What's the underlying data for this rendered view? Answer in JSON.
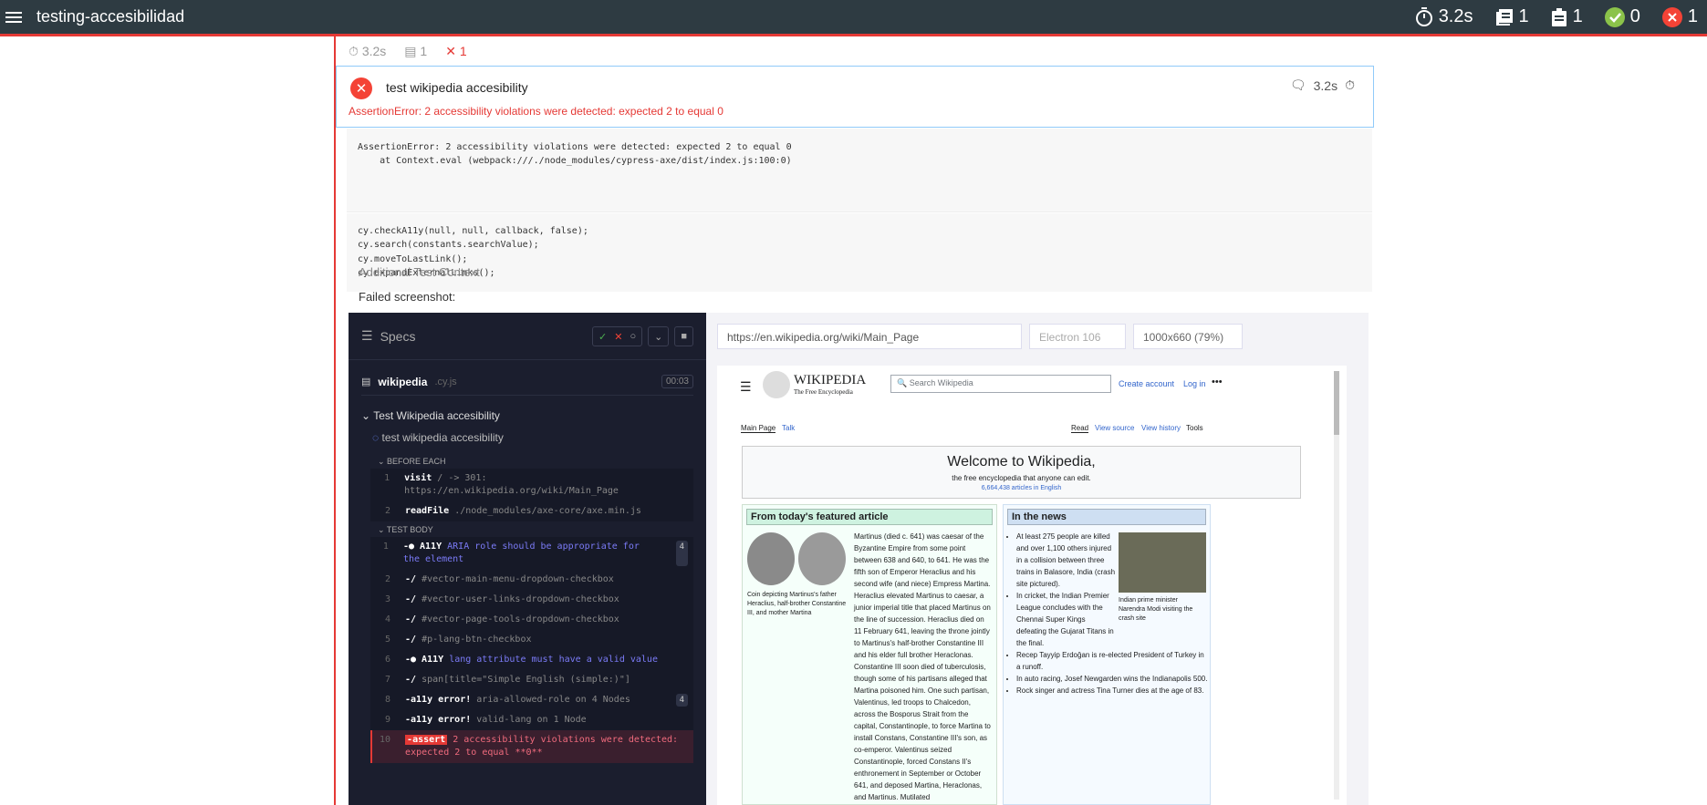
{
  "topbar": {
    "title": "testing-accesibilidad",
    "duration": "3.2s",
    "suites": "1",
    "tests": "1",
    "passed": "0",
    "failed": "1"
  },
  "summary": {
    "duration": "3.2s",
    "suites": "1",
    "failed": "1"
  },
  "test": {
    "title": "test wikipedia accesibility",
    "duration": "3.2s",
    "error": "AssertionError: 2 accessibility violations were detected: expected 2 to equal 0",
    "stack_line1": "AssertionError: 2 accessibility violations were detected: expected 2 to equal 0",
    "stack_line2": "    at Context.eval (webpack:///./node_modules/cypress-axe/dist/index.js:100:0)",
    "code": [
      "cy.checkA11y(null, null, callback, false);",
      "cy.search(constants.searchValue);",
      "cy.moveToLastLink();",
      "cy.expandExternalLinks();"
    ],
    "context_title": "Additional Test Context",
    "failed_screenshot": "Failed screenshot:"
  },
  "runner": {
    "specs_label": "Specs",
    "spec_file": "wikipedia",
    "spec_ext": ".cy.js",
    "spec_time": "00:03",
    "suite": "Test Wikipedia accesibility",
    "test": "test wikipedia accesibility",
    "before_each": "BEFORE EACH",
    "test_body": "TEST BODY",
    "before_cmds": [
      {
        "n": "1",
        "name": "visit",
        "arg": "/ -> 301: https://en.wikipedia.org/wiki/Main_Page"
      },
      {
        "n": "2",
        "name": "readFile",
        "arg": "./node_modules/axe-core/axe.min.js"
      }
    ],
    "body_cmds": [
      {
        "n": "1",
        "name": "-● A11Y",
        "arg": "ARIA role should be appropriate for the element",
        "badge": "4"
      },
      {
        "n": "2",
        "name": "-/",
        "arg": "#vector-main-menu-dropdown-checkbox",
        "badge": ""
      },
      {
        "n": "3",
        "name": "-/",
        "arg": "#vector-user-links-dropdown-checkbox",
        "badge": ""
      },
      {
        "n": "4",
        "name": "-/",
        "arg": "#vector-page-tools-dropdown-checkbox",
        "badge": ""
      },
      {
        "n": "5",
        "name": "-/",
        "arg": "#p-lang-btn-checkbox",
        "badge": ""
      },
      {
        "n": "6",
        "name": "-● A11Y",
        "arg": "lang attribute must have a valid value",
        "badge": ""
      },
      {
        "n": "7",
        "name": "-/",
        "arg": "span[title=\"Simple English (simple:)\"]",
        "badge": ""
      },
      {
        "n": "8",
        "name": "-a11y error!",
        "arg": "aria-allowed-role on 4 Nodes",
        "badge": "4"
      },
      {
        "n": "9",
        "name": "-a11y error!",
        "arg": "valid-lang on 1 Node",
        "badge": ""
      },
      {
        "n": "10",
        "name": "-assert",
        "arg": "2 accessibility violations were detected: expected 2 to equal **0**",
        "badge": ""
      }
    ]
  },
  "browser": {
    "url": "https://en.wikipedia.org/wiki/Main_Page",
    "engine": "Electron 106",
    "viewport": "1000x660 (79%)"
  },
  "wiki": {
    "logo": "WIKIPEDIA",
    "tagline": "The Free Encyclopedia",
    "search_placeholder": "Search Wikipedia",
    "create_account": "Create account",
    "login": "Log in",
    "tab_main": "Main Page",
    "tab_talk": "Talk",
    "tab_read": "Read",
    "tab_source": "View source",
    "tab_history": "View history",
    "tab_tools": "Tools",
    "welcome": "Welcome to Wikipedia,",
    "welcome_sub": "the free encyclopedia that anyone can edit.",
    "articles": "6,664,438 articles in English",
    "featured_title": "From today's featured article",
    "news_title": "In the news",
    "caption": "Coin depicting Martinus's father Heraclius, half-brother Constantine III, and mother Martina",
    "featured_text": "Martinus (died c. 641) was caesar of the Byzantine Empire from some point between 638 and 640, to 641. He was the fifth son of Emperor Heraclius and his second wife (and niece) Empress Martina. Heraclius elevated Martinus to caesar, a junior imperial title that placed Martinus on the line of succession. Heraclius died on 11 February 641, leaving the throne jointly to Martinus's half-brother Constantine III and his elder full brother Heraclonas. Constantine III soon died of tuberculosis, though some of his partisans alleged that Martina poisoned him. One such partisan, Valentinus, led troops to Chalcedon, across the Bosporus Strait from the capital, Constantinople, to force Martina to install Constans, Constantine III's son, as co-emperor. Valentinus seized Constantinople, forced Constans II's enthronement in September or October 641, and deposed Martina, Heraclonas, and Martinus. Mutilated",
    "news_items": [
      "At least 275 people are killed and over 1,100 others injured in a collision between three trains in Balasore, India (crash site pictured).",
      "In cricket, the Indian Premier League concludes with the Chennai Super Kings defeating the Gujarat Titans in the final.",
      "Recep Tayyip Erdoğan is re-elected President of Turkey in a runoff.",
      "In auto racing, Josef Newgarden wins the Indianapolis 500.",
      "Rock singer and actress Tina Turner dies at the age of 83."
    ],
    "news_caption": "Indian prime minister Narendra Modi visiting the crash site"
  }
}
